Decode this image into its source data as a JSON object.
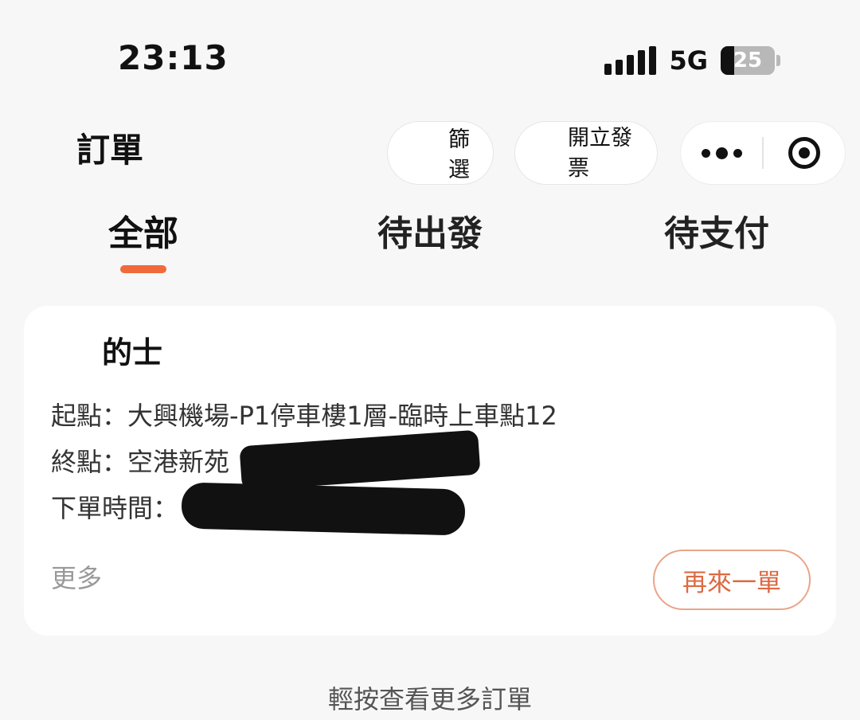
{
  "status_bar": {
    "time": "23:13",
    "network": "5G",
    "battery_level": 25,
    "battery_text": "25",
    "signal_icon": "signal-bars-icon",
    "battery_icon": "battery-icon"
  },
  "header": {
    "title": "訂單",
    "filter_label": "篩選",
    "invoice_label": "開立發票",
    "more_icon": "more-dots-icon",
    "close_icon": "close-target-icon"
  },
  "tabs": [
    {
      "label": "全部",
      "active": true
    },
    {
      "label": "待出發",
      "active": false
    },
    {
      "label": "待支付",
      "active": false
    }
  ],
  "order": {
    "service_type": "的士",
    "origin_label": "起點：",
    "origin_value": "大興機場-P1停車樓1層-臨時上車點12",
    "destination_label": "終點：",
    "destination_value": "空港新苑",
    "time_label": "下單時間：",
    "more_label": "更多",
    "reorder_label": "再來一單"
  },
  "footer": {
    "load_more": "輕按查看更多訂單"
  },
  "colors": {
    "accent": "#f06a3c",
    "reorder_text": "#dc6a43",
    "reorder_border": "#e8a58a",
    "background": "#f7f7f7",
    "card": "#ffffff"
  }
}
